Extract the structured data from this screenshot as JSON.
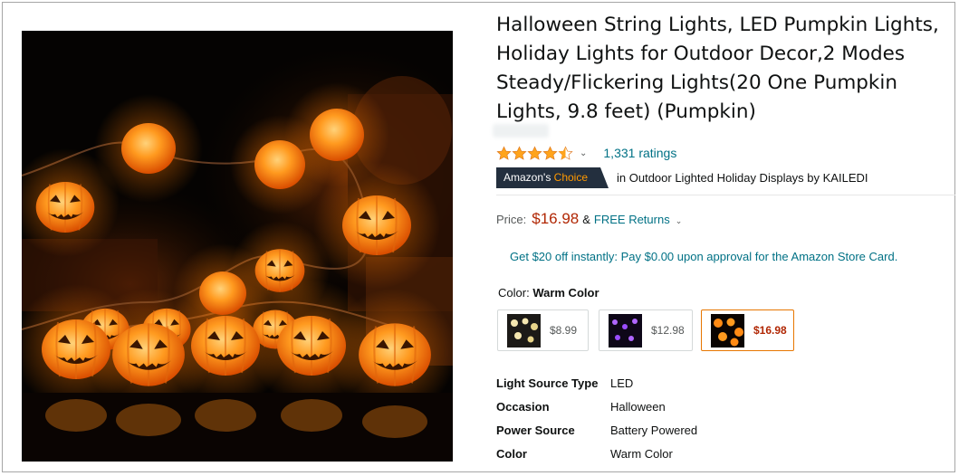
{
  "product": {
    "title": "Halloween String Lights, LED Pumpkin Lights, Holiday Lights for Outdoor Decor,2 Modes Steady/Flickering Lights(20 One Pumpkin Lights, 9.8 feet) (Pumpkin)",
    "image_alt": "Pumpkin string lights glowing orange",
    "rating_stars": 4.5,
    "ratings_count": "1,331 ratings",
    "badge": {
      "prefix": "Amazon's",
      "accent": "Choice"
    },
    "badge_context": "in Outdoor Lighted Holiday Displays by KAILEDI"
  },
  "pricing": {
    "label": "Price:",
    "price": "$16.98",
    "amp": "&",
    "free_returns": "FREE Returns",
    "promo": "Get $20 off instantly: Pay $0.00 upon approval for the Amazon Store Card."
  },
  "color": {
    "label": "Color:",
    "selected": "Warm Color",
    "options": [
      {
        "price": "$8.99",
        "theme": "white-lights"
      },
      {
        "price": "$12.98",
        "theme": "purple-lights"
      },
      {
        "price": "$16.98",
        "theme": "pumpkin-lights",
        "selected": true
      }
    ]
  },
  "specs": [
    {
      "key": "Light Source Type",
      "value": "LED"
    },
    {
      "key": "Occasion",
      "value": "Halloween"
    },
    {
      "key": "Power Source",
      "value": "Battery Powered"
    },
    {
      "key": "Color",
      "value": "Warm Color"
    }
  ],
  "colors": {
    "link": "#007185",
    "price": "#b12704",
    "star": "#ffa41c",
    "badge_bg": "#232f3e",
    "badge_accent": "#ff9900",
    "selected_border": "#e77600"
  },
  "icons": [
    "star-icon",
    "chevron-down-icon"
  ]
}
